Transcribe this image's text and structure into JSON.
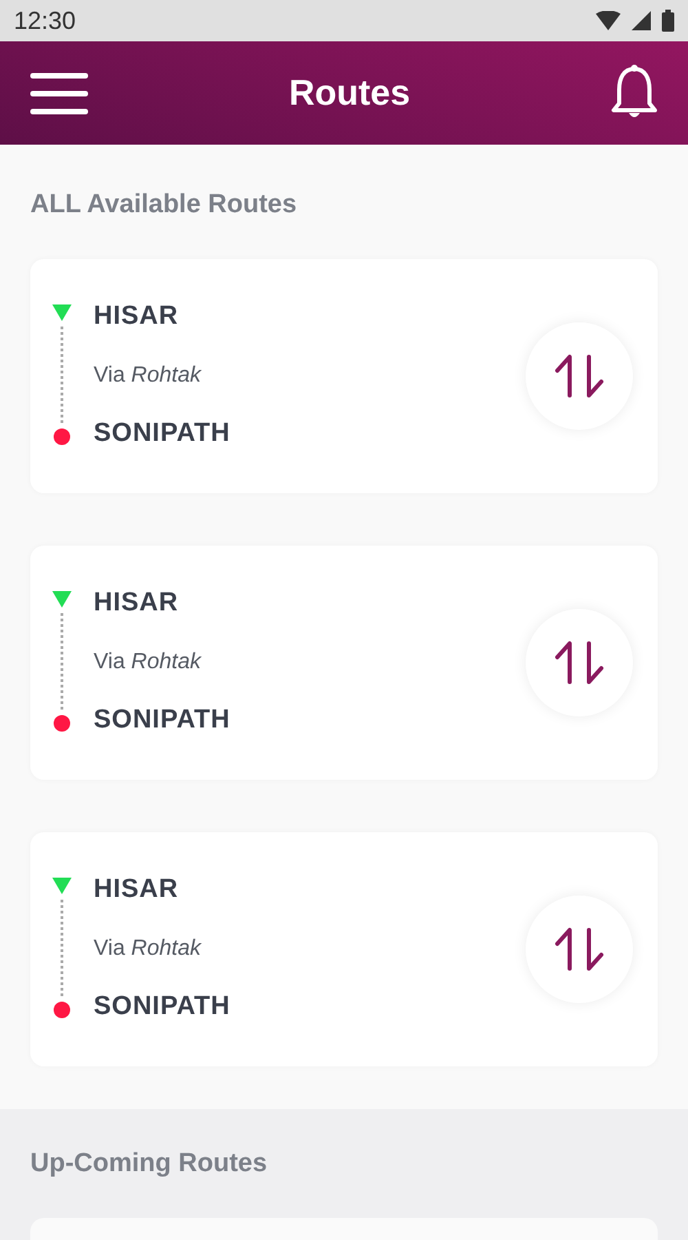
{
  "status_bar": {
    "time": "12:30"
  },
  "header": {
    "title": "Routes"
  },
  "sections": [
    {
      "title": "ALL Available Routes",
      "kind": "list",
      "routes": [
        {
          "from": "HISAR",
          "via": "Via *Rohtak*",
          "to": "SONIPATH"
        },
        {
          "from": "HISAR",
          "via": "Via *Rohtak*",
          "to": "SONIPATH"
        },
        {
          "from": "HISAR",
          "via": "Via *Rohtak*",
          "to": "SONIPATH"
        }
      ]
    },
    {
      "title": "Up-Coming Routes",
      "kind": "upcoming"
    }
  ]
}
